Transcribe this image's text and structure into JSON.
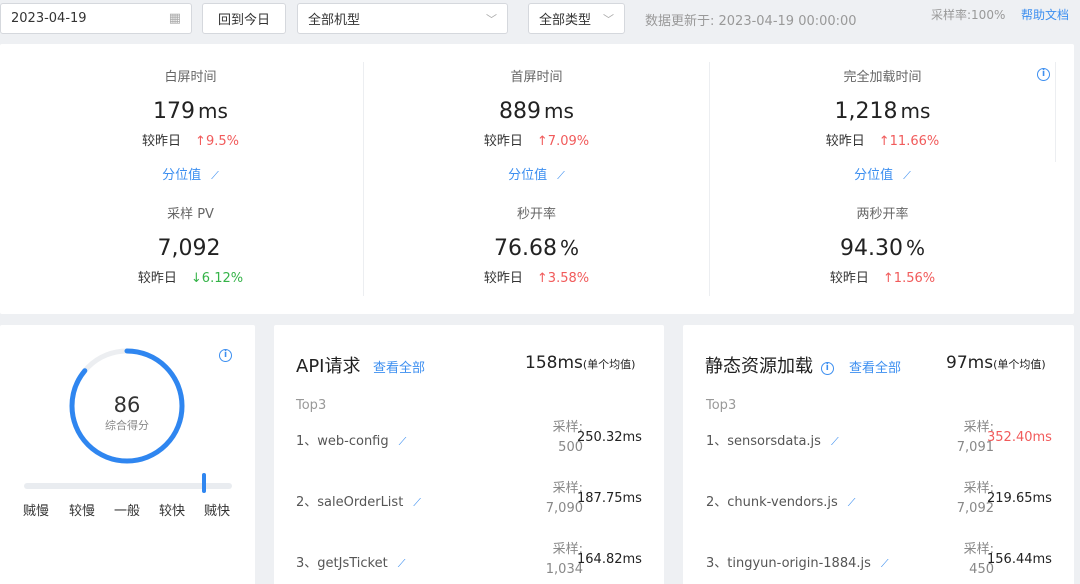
{
  "toolbar": {
    "date_value": "2023-04-19",
    "today_label": "回到今日",
    "device_select": "全部机型",
    "type_select": "全部类型",
    "updated_text": "数据更新于: 2023-04-19 00:00:00",
    "sample_rate": "采样率:100%",
    "help_label": "帮助文档"
  },
  "metrics": [
    {
      "label": "白屏时间",
      "value": "179",
      "unit": "ms",
      "compare_label": "较昨日",
      "change": "↑9.5%",
      "dir": "up",
      "percentile": "分位值"
    },
    {
      "label": "首屏时间",
      "value": "889",
      "unit": "ms",
      "compare_label": "较昨日",
      "change": "↑7.09%",
      "dir": "up",
      "percentile": "分位值"
    },
    {
      "label": "完全加载时间",
      "value": "1,218",
      "unit": "ms",
      "compare_label": "较昨日",
      "change": "↑11.66%",
      "dir": "up",
      "percentile": "分位值"
    },
    {
      "label": "采样 PV",
      "value": "7,092",
      "unit": "",
      "compare_label": "较昨日",
      "change": "↓6.12%",
      "dir": "down"
    },
    {
      "label": "秒开率",
      "value": "76.68",
      "unit": "%",
      "compare_label": "较昨日",
      "change": "↑3.58%",
      "dir": "up"
    },
    {
      "label": "两秒开率",
      "value": "94.30",
      "unit": "%",
      "compare_label": "较昨日",
      "change": "↑1.56%",
      "dir": "up"
    }
  ],
  "score": {
    "value": "86",
    "label": "综合得分",
    "progress": 0.86,
    "scale": [
      "贼慢",
      "较慢",
      "一般",
      "较快",
      "贼快"
    ]
  },
  "api": {
    "title": "API请求",
    "view_all": "查看全部",
    "avg": "158ms",
    "avg_note": "(单个均值)",
    "top_label": "Top3",
    "sample_label": "采样:",
    "rows": [
      {
        "name": "1、web-config",
        "samples": "500",
        "time": "250.32ms",
        "alert": false
      },
      {
        "name": "2、saleOrderList",
        "samples": "7,090",
        "time": "187.75ms",
        "alert": false
      },
      {
        "name": "3、getJsTicket",
        "samples": "1,034",
        "time": "164.82ms",
        "alert": false
      }
    ]
  },
  "static": {
    "title": "静态资源加载",
    "view_all": "查看全部",
    "avg": "97ms",
    "avg_note": "(单个均值)",
    "top_label": "Top3",
    "sample_label": "采样:",
    "rows": [
      {
        "name": "1、sensorsdata.js",
        "samples": "7,091",
        "time": "352.40ms",
        "alert": true
      },
      {
        "name": "2、chunk-vendors.js",
        "samples": "7,092",
        "time": "219.65ms",
        "alert": false
      },
      {
        "name": "3、tingyun-origin-1884.js",
        "samples": "450",
        "time": "156.44ms",
        "alert": false
      }
    ]
  },
  "colors": {
    "accent": "#3d8ff0",
    "up": "#f15b5b",
    "down": "#35b348",
    "alert": "#f15b5b"
  }
}
